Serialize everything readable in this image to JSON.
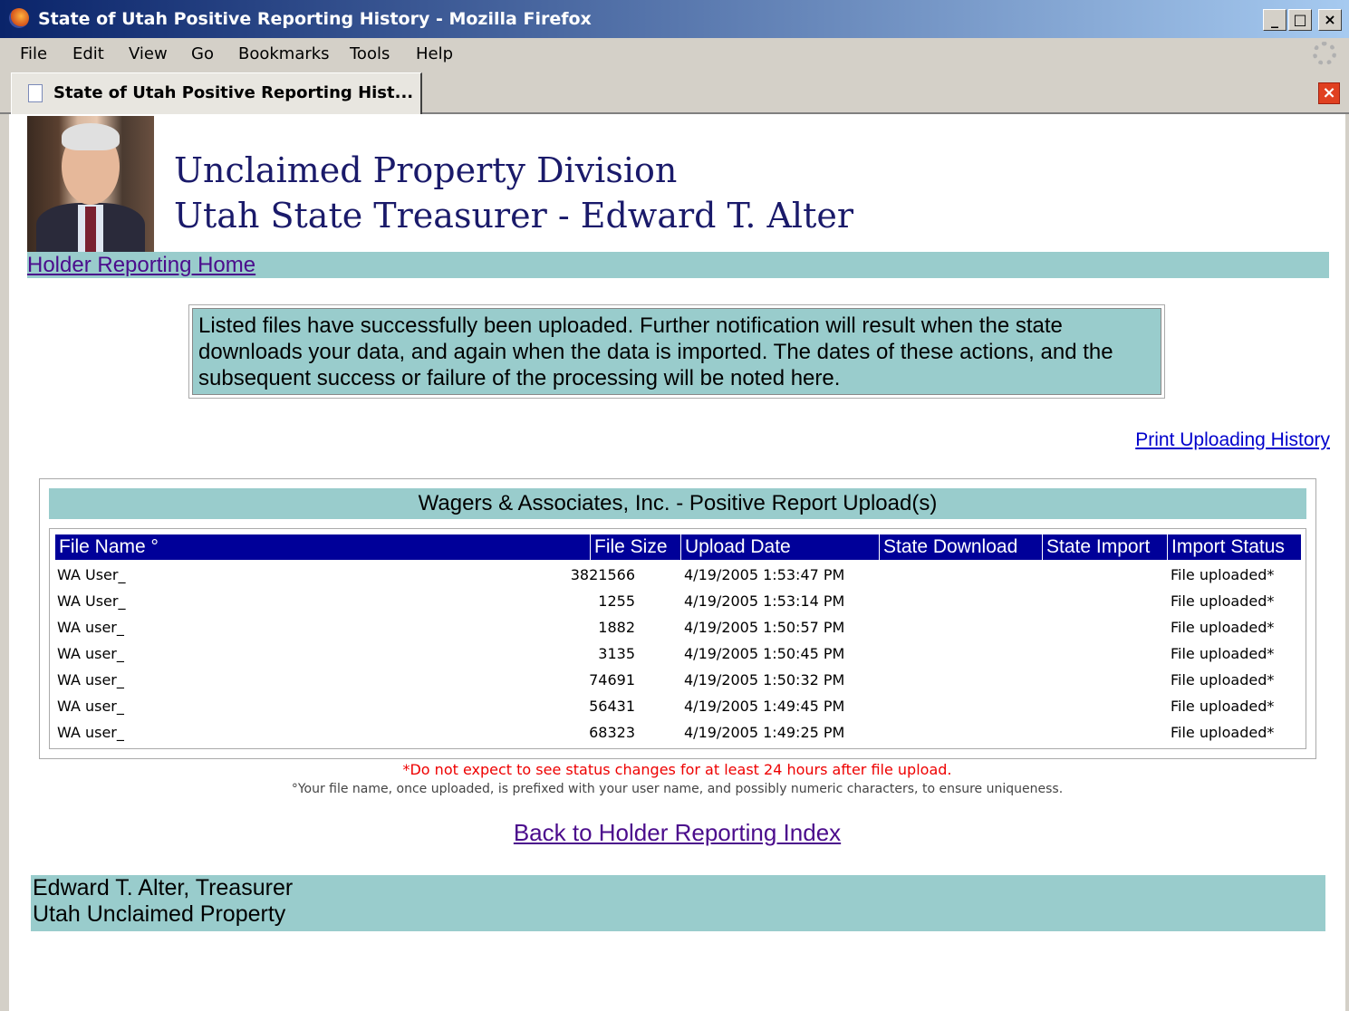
{
  "window": {
    "title": "State of Utah Positive Reporting History - Mozilla Firefox",
    "controls": {
      "minimize": "_",
      "maximize": "□",
      "close": "×"
    }
  },
  "menu": [
    "File",
    "Edit",
    "View",
    "Go",
    "Bookmarks",
    "Tools",
    "Help"
  ],
  "tab": {
    "label": "State of Utah Positive Reporting Hist...",
    "close": "×"
  },
  "header": {
    "line1": "Unclaimed Property Division",
    "line2": "Utah State Treasurer - Edward T. Alter"
  },
  "nav": {
    "home_link": "Holder Reporting Home"
  },
  "notice": "Listed files have successfully been uploaded. Further notification will result when the state downloads your data, and again when the data is imported. The dates of these actions, and the subsequent success or failure of the processing will be noted here.",
  "print_link": "Print Uploading History",
  "table": {
    "title": "Wagers & Associates, Inc. - Positive Report Upload(s)",
    "columns": [
      "File Name °",
      "File Size",
      "Upload Date",
      "State Download",
      "State Import",
      "Import Status"
    ],
    "rows": [
      {
        "name": "WA User_",
        "size": "3821566",
        "date": "4/19/2005 1:53:47 PM",
        "download": "",
        "import": "",
        "status": "File uploaded*"
      },
      {
        "name": "WA User_",
        "size": "1255",
        "date": "4/19/2005 1:53:14 PM",
        "download": "",
        "import": "",
        "status": "File uploaded*"
      },
      {
        "name": "WA user_",
        "size": "1882",
        "date": "4/19/2005 1:50:57 PM",
        "download": "",
        "import": "",
        "status": "File uploaded*"
      },
      {
        "name": "WA user_",
        "size": "3135",
        "date": "4/19/2005 1:50:45 PM",
        "download": "",
        "import": "",
        "status": "File uploaded*"
      },
      {
        "name": "WA user_",
        "size": "74691",
        "date": "4/19/2005 1:50:32 PM",
        "download": "",
        "import": "",
        "status": "File uploaded*"
      },
      {
        "name": "WA user_",
        "size": "56431",
        "date": "4/19/2005 1:49:45 PM",
        "download": "",
        "import": "",
        "status": "File uploaded*"
      },
      {
        "name": "WA user_",
        "size": "68323",
        "date": "4/19/2005 1:49:25 PM",
        "download": "",
        "import": "",
        "status": "File uploaded*"
      }
    ]
  },
  "notes": {
    "red": "*Do not expect to see status changes for at least 24 hours after file upload.",
    "grey": "°Your file name, once uploaded, is prefixed with your user name, and possibly numeric characters, to ensure uniqueness."
  },
  "back_link": "Back to Holder Reporting Index",
  "footer": {
    "line1": "Edward T. Alter, Treasurer",
    "line2": "Utah Unclaimed Property"
  },
  "colors": {
    "teal": "#99cccc",
    "header_blue": "#000099",
    "link_purple": "#4b0c8c",
    "link_blue": "#0000cc",
    "warning_red": "#ee0000"
  }
}
